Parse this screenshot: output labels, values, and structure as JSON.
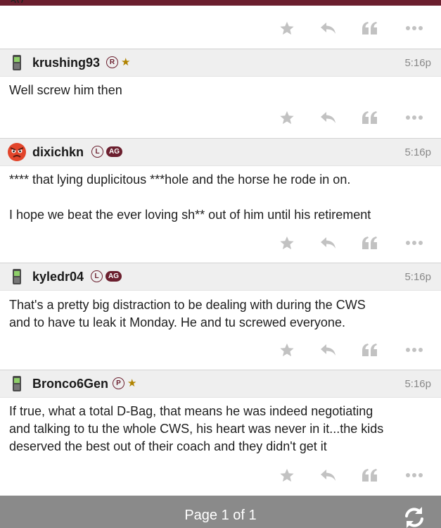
{
  "partial_top_text": "ay",
  "colors": {
    "brand": "#6b1f2e",
    "header_bg": "#efefef",
    "footer_bg": "#8a8a8a",
    "star_gold": "#b08300",
    "icon_gray": "#c2c2c2"
  },
  "icons": {
    "star": "star-icon",
    "reply": "reply-icon",
    "quote": "quote-icon",
    "more": "more-icon",
    "refresh": "refresh-icon"
  },
  "posts": [
    {
      "username": "krushing93",
      "avatar": "phone-icon",
      "badges": [
        {
          "type": "circle",
          "text": "R"
        },
        {
          "type": "star",
          "text": "★"
        }
      ],
      "time": "5:16p",
      "lines": [
        "Well screw him then"
      ]
    },
    {
      "username": "dixichkn",
      "avatar": "angry-face-icon",
      "badges": [
        {
          "type": "circle",
          "text": "L"
        },
        {
          "type": "ag",
          "text": "AG"
        }
      ],
      "time": "5:16p",
      "lines": [
        "**** that lying duplicitous ***hole and the horse he rode in on.",
        "",
        "I hope we beat the ever loving sh** out of him until his retirement"
      ]
    },
    {
      "username": "kyledr04",
      "avatar": "phone-icon",
      "badges": [
        {
          "type": "circle",
          "text": "L"
        },
        {
          "type": "ag",
          "text": "AG"
        }
      ],
      "time": "5:16p",
      "lines": [
        "That's a pretty big distraction to be dealing with during the CWS",
        "and to have tu leak it Monday. He and tu screwed everyone."
      ]
    },
    {
      "username": "Bronco6Gen",
      "avatar": "phone-icon",
      "badges": [
        {
          "type": "circle",
          "text": "P"
        },
        {
          "type": "star",
          "text": "★"
        }
      ],
      "time": "5:16p",
      "lines": [
        "If true, what a total D-Bag, that means he was indeed negotiating",
        "and talking to tu the whole CWS, his heart was never in it...the kids",
        "deserved the best out of their coach and they didn't get it"
      ]
    }
  ],
  "footer": {
    "page_label": "Page 1 of 1"
  }
}
